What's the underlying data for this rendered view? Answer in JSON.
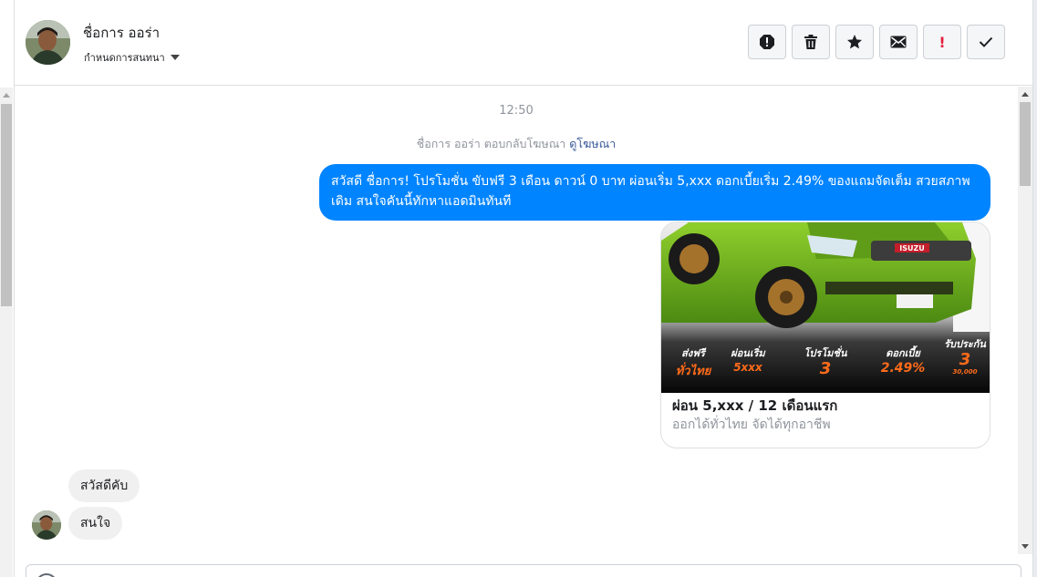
{
  "header": {
    "name": "ชื่อการ ออร่า",
    "subtitle": "กำหนดการสนทนา"
  },
  "actions": [
    {
      "icon": "spam-alert-icon"
    },
    {
      "icon": "trash-icon"
    },
    {
      "icon": "star-icon"
    },
    {
      "icon": "mail-icon"
    },
    {
      "icon": "important-icon",
      "glyph": "!"
    },
    {
      "icon": "check-icon"
    }
  ],
  "thread": {
    "timestamp": "12:50",
    "system_note": "ชื่อการ ออร่า ตอบกลับโฆษณา ",
    "system_note_link": "ดูโฆษณา",
    "outgoing_message": "สวัสดี ชื่อการ! โปรโมชั่น ขับฟรี 3 เดือน ดาวน์ 0 บาท ผ่อนเริ่ม 5,xxx  ดอกเบี้ยเริ่ม 2.49% ของแถมจัดเต็ม สวยสภาพเดิม สนใจคันนี้ทักหาแอดมินทันที",
    "ad_card": {
      "brand": "ISUZU",
      "promo": {
        "p1_top": "ส่งฟรี",
        "p1_bottom": "ทั่วไทย",
        "p2_top": "ผ่อนเริ่ม",
        "p2_bottom": "5xxx",
        "p3_top": "โปรโมชั่น",
        "p3_bottom": "3",
        "p4_top": "ดอกเบี้ย",
        "p4_bottom": "2.49%",
        "p5_top": "รับประกัน",
        "p5_bottom": "3",
        "p5_note": "30,000"
      },
      "title": "ผ่อน 5,xxx / 12 เดือนแรก",
      "description": "ออกได้ทั่วไทย จัดได้ทุกอาชีพ"
    },
    "incoming_messages": [
      "สวัสดีคับ",
      "สนใจ"
    ]
  },
  "colors": {
    "accent": "#0084ff",
    "link": "#385898",
    "incoming_bubble": "#f1f0f0",
    "car_green": "#6aa51f"
  }
}
